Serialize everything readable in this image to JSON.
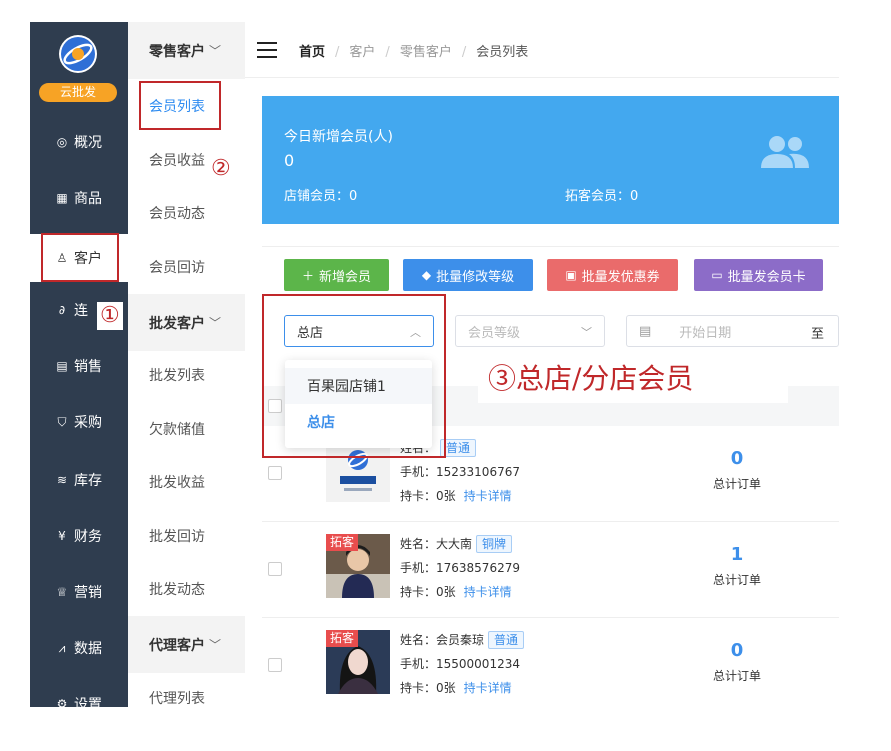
{
  "logo": {
    "badge": "云批发"
  },
  "leftnav": {
    "items": [
      {
        "icon": "dashboard-icon",
        "glyph": "◎",
        "label": "概况"
      },
      {
        "icon": "grid-icon",
        "glyph": "▦",
        "label": "商品"
      },
      {
        "icon": "user-icon",
        "glyph": "♙",
        "label": "客户"
      },
      {
        "icon": "link-icon",
        "glyph": "∂",
        "label": "连"
      },
      {
        "icon": "receipt-icon",
        "glyph": "▤",
        "label": "销售"
      },
      {
        "icon": "purchase-icon",
        "glyph": "⛉",
        "label": "采购"
      },
      {
        "icon": "stack-icon",
        "glyph": "≋",
        "label": "库存"
      },
      {
        "icon": "yen-icon",
        "glyph": "¥",
        "label": "财务"
      },
      {
        "icon": "crown-icon",
        "glyph": "♕",
        "label": "营销"
      },
      {
        "icon": "chart-icon",
        "glyph": "⩘",
        "label": "数据"
      },
      {
        "icon": "settings-icon",
        "glyph": "⚙",
        "label": "设置"
      }
    ]
  },
  "subnav": {
    "group1": "零售客户",
    "group1_items": [
      "会员列表",
      "会员收益",
      "会员动态",
      "会员回访"
    ],
    "group2": "批发客户",
    "group2_items": [
      "批发列表",
      "欠款储值",
      "批发收益",
      "批发回访",
      "批发动态"
    ],
    "group3": "代理客户",
    "group3_items": [
      "代理列表"
    ]
  },
  "breadcrumb": {
    "home": "首页",
    "b1": "客户",
    "b2": "零售客户",
    "b3": "会员列表"
  },
  "stats": {
    "title": "今日新增会员(人)",
    "value": "0",
    "store_members": "店铺会员：0",
    "expand_members": "拓客会员：0"
  },
  "actions": {
    "add": "新增会员",
    "batch_level": "批量修改等级",
    "batch_coupon": "批量发优惠券",
    "batch_card": "批量发会员卡"
  },
  "filters": {
    "store": "总店",
    "level_placeholder": "会员等级",
    "start_date_placeholder": "开始日期",
    "to": "至",
    "store_options": [
      "百果园店铺1",
      "总店"
    ]
  },
  "members": [
    {
      "tag": "",
      "name": "姓名：",
      "level": "普通",
      "phone": "手机：15233106767",
      "cards": "持卡：0张",
      "card_link": "持卡详情",
      "orders": "0",
      "orders_label": "总计订单"
    },
    {
      "tag": "拓客",
      "name": "姓名：大大南",
      "level": "铜牌",
      "phone": "手机：17638576279",
      "cards": "持卡：0张",
      "card_link": "持卡详情",
      "orders": "1",
      "orders_label": "总计订单"
    },
    {
      "tag": "拓客",
      "name": "姓名：会员秦琼",
      "level": "普通",
      "phone": "手机：15500001234",
      "cards": "持卡：0张",
      "card_link": "持卡详情",
      "orders": "0",
      "orders_label": "总计订单"
    }
  ],
  "annotations": {
    "n1": "①",
    "n2": "②",
    "n3": "③总店/分店会员"
  },
  "colors": {
    "sidebar": "#2f3d4f",
    "accent": "#3d8fea",
    "stat_bg": "#43a8ef",
    "badge": "#f7a325",
    "annotation": "#c0282a"
  }
}
